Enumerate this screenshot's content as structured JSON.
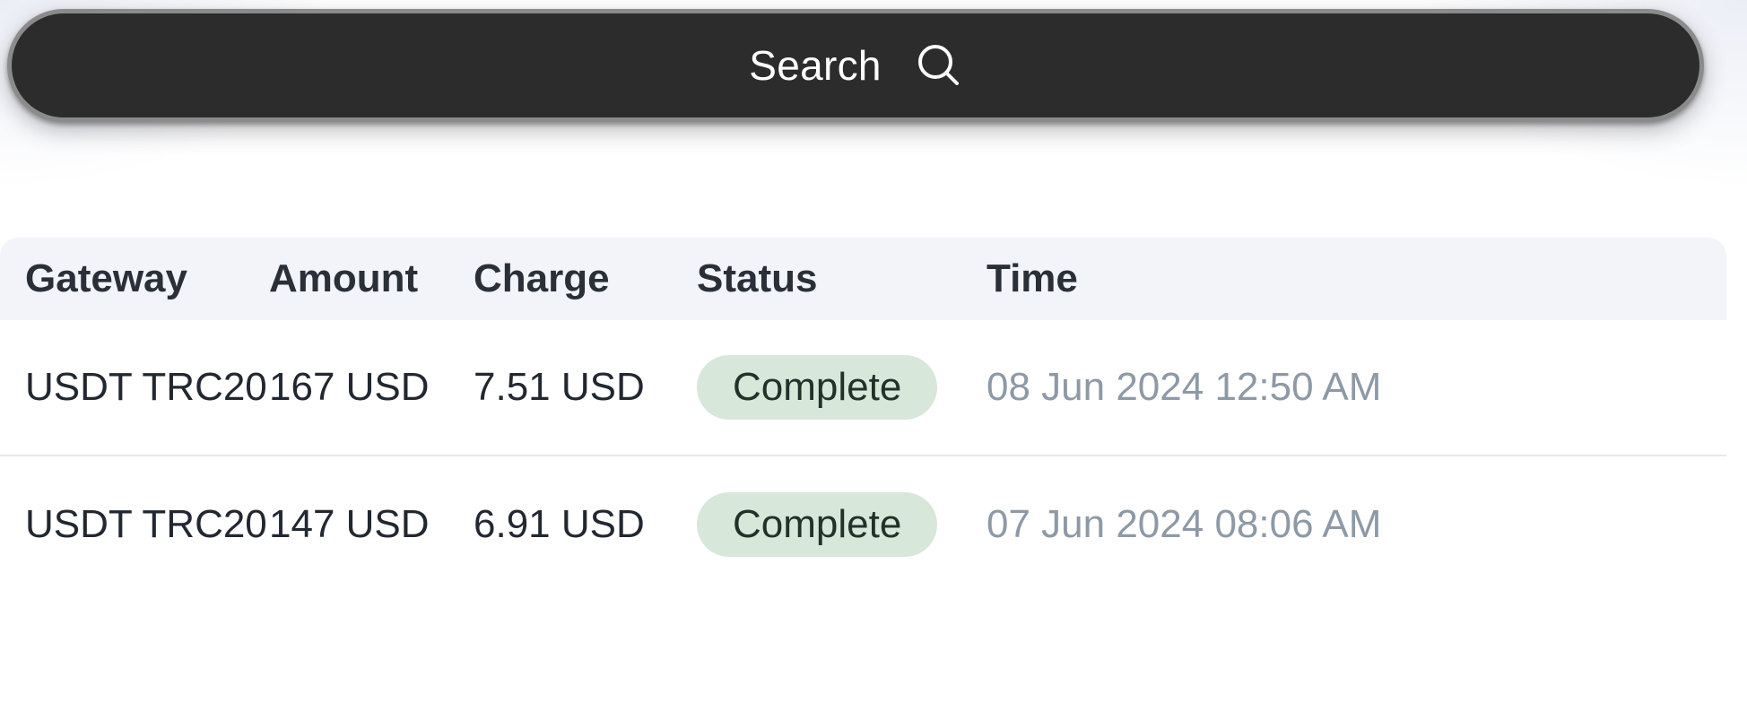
{
  "search": {
    "label": "Search",
    "icon": "search-icon",
    "background_color": "#2c2c2c",
    "text_color": "#ffffff"
  },
  "table": {
    "header_background": "#f3f4fa",
    "columns": [
      {
        "key": "gateway",
        "label": "Gateway"
      },
      {
        "key": "amount",
        "label": "Amount"
      },
      {
        "key": "charge",
        "label": "Charge"
      },
      {
        "key": "status",
        "label": "Status"
      },
      {
        "key": "time",
        "label": "Time"
      }
    ],
    "rows": [
      {
        "gateway": "USDT TRC20",
        "amount": "167 USD",
        "charge": "7.51 USD",
        "status": "Complete",
        "time": "08 Jun 2024 12:50 AM"
      },
      {
        "gateway": "USDT TRC20",
        "amount": "147 USD",
        "charge": "6.91 USD",
        "status": "Complete",
        "time": "07 Jun 2024 08:06 AM"
      }
    ],
    "status_badge": {
      "background_color": "#d7e7d9",
      "text_color": "#22312a"
    },
    "time_text_color": "#8d99a6"
  }
}
